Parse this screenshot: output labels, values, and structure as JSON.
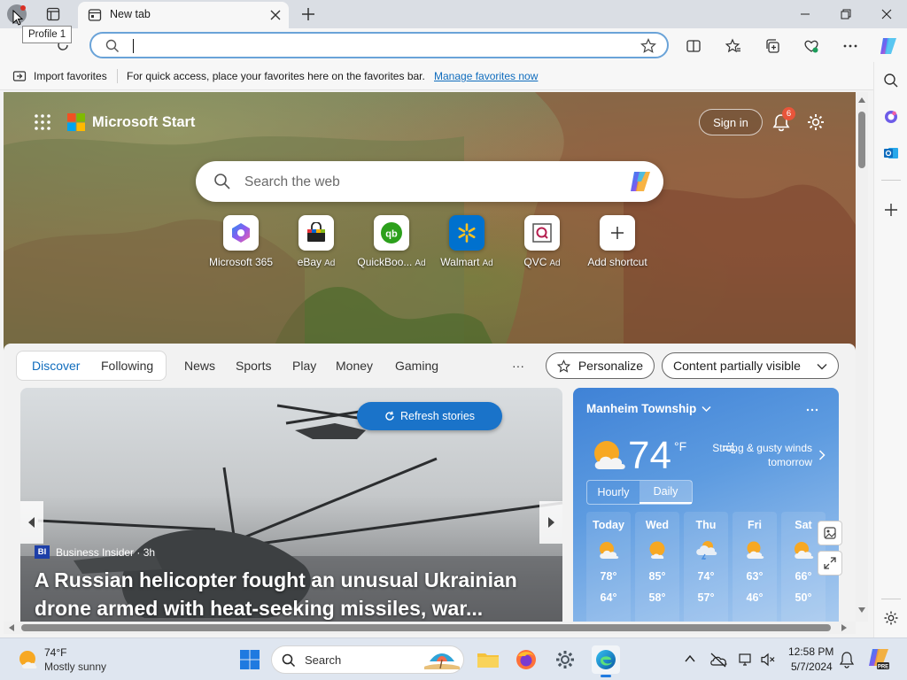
{
  "browser": {
    "tab_title": "New tab",
    "profile_tooltip": "Profile 1",
    "address_value": ""
  },
  "favorites_bar": {
    "import_label": "Import favorites",
    "hint": "For quick access, place your favorites here on the favorites bar.",
    "manage_link": "Manage favorites now"
  },
  "msn": {
    "brand": "Microsoft Start",
    "sign_in": "Sign in",
    "notification_count": "6",
    "search_placeholder": "Search the web",
    "shortcuts": [
      {
        "label": "Microsoft 365",
        "ad": "",
        "icon": "microsoft-365-icon"
      },
      {
        "label": "eBay",
        "ad": "Ad",
        "icon": "ebay-icon"
      },
      {
        "label": "QuickBoo...",
        "ad": "Ad",
        "icon": "quickbooks-icon"
      },
      {
        "label": "Walmart",
        "ad": "Ad",
        "icon": "walmart-icon"
      },
      {
        "label": "QVC",
        "ad": "Ad",
        "icon": "qvc-icon"
      },
      {
        "label": "Add shortcut",
        "ad": "",
        "icon": "plus-icon"
      }
    ]
  },
  "feed_nav": {
    "discover": "Discover",
    "following": "Following",
    "items": [
      "News",
      "Sports",
      "Play",
      "Money",
      "Gaming"
    ],
    "more": "···",
    "personalize": "Personalize",
    "content_visibility": "Content partially visible"
  },
  "story": {
    "refresh": "Refresh stories",
    "source_logo": "BI",
    "source": "Business Insider · 3h",
    "headline": "A Russian helicopter fought an unusual Ukrainian drone armed with heat-seeking missiles, war..."
  },
  "weather": {
    "location": "Manheim Township",
    "temp": "74",
    "unit": "°F",
    "description": "Strong & gusty winds tomorrow",
    "tab_hourly": "Hourly",
    "tab_daily": "Daily",
    "days": [
      {
        "name": "Today",
        "hi": "78°",
        "lo": "64°"
      },
      {
        "name": "Wed",
        "hi": "85°",
        "lo": "58°"
      },
      {
        "name": "Thu",
        "hi": "74°",
        "lo": "57°"
      },
      {
        "name": "Fri",
        "hi": "63°",
        "lo": "46°"
      },
      {
        "name": "Sat",
        "hi": "66°",
        "lo": "50°"
      }
    ]
  },
  "taskbar": {
    "weather_temp": "74°F",
    "weather_desc": "Mostly sunny",
    "search_label": "Search",
    "time": "12:58 PM",
    "date": "5/7/2024"
  },
  "colors": {
    "accent": "#1a73c9",
    "link": "#0f6cbd",
    "notification_badge": "#e8553a"
  }
}
